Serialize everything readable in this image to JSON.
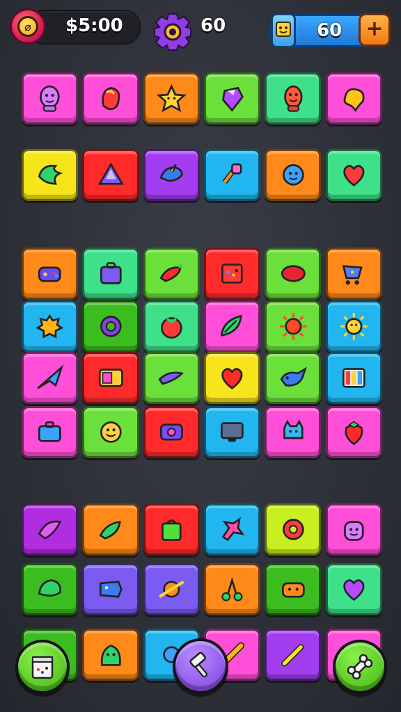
{
  "hud": {
    "coins_label": "$5:00",
    "gear_value": "60",
    "score_value": "60",
    "coin_icon": "no-coin-icon",
    "gear_icon": "gear-icon",
    "score_icon": "smiley-card-icon",
    "add_icon": "plus-icon"
  },
  "board": {
    "columns": 6,
    "tiles": [
      {
        "color": "#ff4fd8",
        "icon": "purple-face"
      },
      {
        "color": "#ff4fd8",
        "icon": "red-blob"
      },
      {
        "color": "#ff8a1a",
        "icon": "star"
      },
      {
        "color": "#6be03a",
        "icon": "gem-purple"
      },
      {
        "color": "#3ee08a",
        "icon": "red-face"
      },
      {
        "color": "#ff4fd8",
        "icon": "yellow-blob"
      },
      {
        "color": "#f5e51a",
        "icon": "green-leaf"
      },
      {
        "color": "#ff2b2b",
        "icon": "triangle"
      },
      {
        "color": "#a23ef0",
        "icon": "blue-bird"
      },
      {
        "color": "#22b6f0",
        "icon": "orange-key"
      },
      {
        "color": "#ff8a1a",
        "icon": "blue-gear"
      },
      {
        "color": "#3ee08a",
        "icon": "red-heart"
      },
      {
        "color": "#ff8a1a",
        "icon": "game-pad"
      },
      {
        "color": "#3ee08a",
        "icon": "suitcase"
      },
      {
        "color": "#6be03a",
        "icon": "red-chili"
      },
      {
        "color": "#ff2b2b",
        "icon": "red-box"
      },
      {
        "color": "#6be03a",
        "icon": "red-lemon"
      },
      {
        "color": "#ff8a1a",
        "icon": "cart"
      },
      {
        "color": "#22b6f0",
        "icon": "orange-splat"
      },
      {
        "color": "#3bbd1f",
        "icon": "purple-ring"
      },
      {
        "color": "#3ee08a",
        "icon": "tomato"
      },
      {
        "color": "#ff4fd8",
        "icon": "green-leaf2"
      },
      {
        "color": "#6be03a",
        "icon": "red-sun"
      },
      {
        "color": "#22b6f0",
        "icon": "yellow-sun"
      },
      {
        "color": "#ff4fd8",
        "icon": "blue-plane"
      },
      {
        "color": "#ff2b2b",
        "icon": "device"
      },
      {
        "color": "#6be03a",
        "icon": "blue-fish"
      },
      {
        "color": "#f5e51a",
        "icon": "red-heart2"
      },
      {
        "color": "#6be03a",
        "icon": "blue-whale"
      },
      {
        "color": "#22b6f0",
        "icon": "bars"
      },
      {
        "color": "#ff4fd8",
        "icon": "blue-case"
      },
      {
        "color": "#6be03a",
        "icon": "yellow-smiley"
      },
      {
        "color": "#ff2b2b",
        "icon": "purple-camera"
      },
      {
        "color": "#22b6f0",
        "icon": "monitor"
      },
      {
        "color": "#ff4fd8",
        "icon": "blue-cat"
      },
      {
        "color": "#ff4fd8",
        "icon": "strawberry"
      },
      {
        "color": "#b02de0",
        "icon": "pink-fish"
      },
      {
        "color": "#ff8a1a",
        "icon": "green-pepper"
      },
      {
        "color": "#ff2b2b",
        "icon": "green-bag"
      },
      {
        "color": "#22b6f0",
        "icon": "pink-splat"
      },
      {
        "color": "#c8f020",
        "icon": "red-donut"
      },
      {
        "color": "#ff4fd8",
        "icon": "purple-monster"
      },
      {
        "color": "#3bbd1f",
        "icon": "green-turtle"
      },
      {
        "color": "#7a5cf0",
        "icon": "blue-fish2"
      },
      {
        "color": "#7a5cf0",
        "icon": "orange-planet"
      },
      {
        "color": "#ff8a1a",
        "icon": "cherries"
      },
      {
        "color": "#3bbd1f",
        "icon": "red-car"
      },
      {
        "color": "#3ee08a",
        "icon": "purple-heart"
      },
      {
        "color": "#3bbd1f",
        "icon": "red-crab"
      },
      {
        "color": "#ff8a1a",
        "icon": "green-dino"
      },
      {
        "color": "#22b6f0",
        "icon": "blue-sun"
      },
      {
        "color": "#ff4fd8",
        "icon": "orange-bone"
      },
      {
        "color": "#a23ef0",
        "icon": "pencil"
      },
      {
        "color": "#ff4fd8",
        "icon": "crystal"
      }
    ]
  },
  "toolbar": {
    "left_icon": "shop-card-icon",
    "center_icon": "hammer-icon",
    "right_icon": "bone-icon"
  }
}
